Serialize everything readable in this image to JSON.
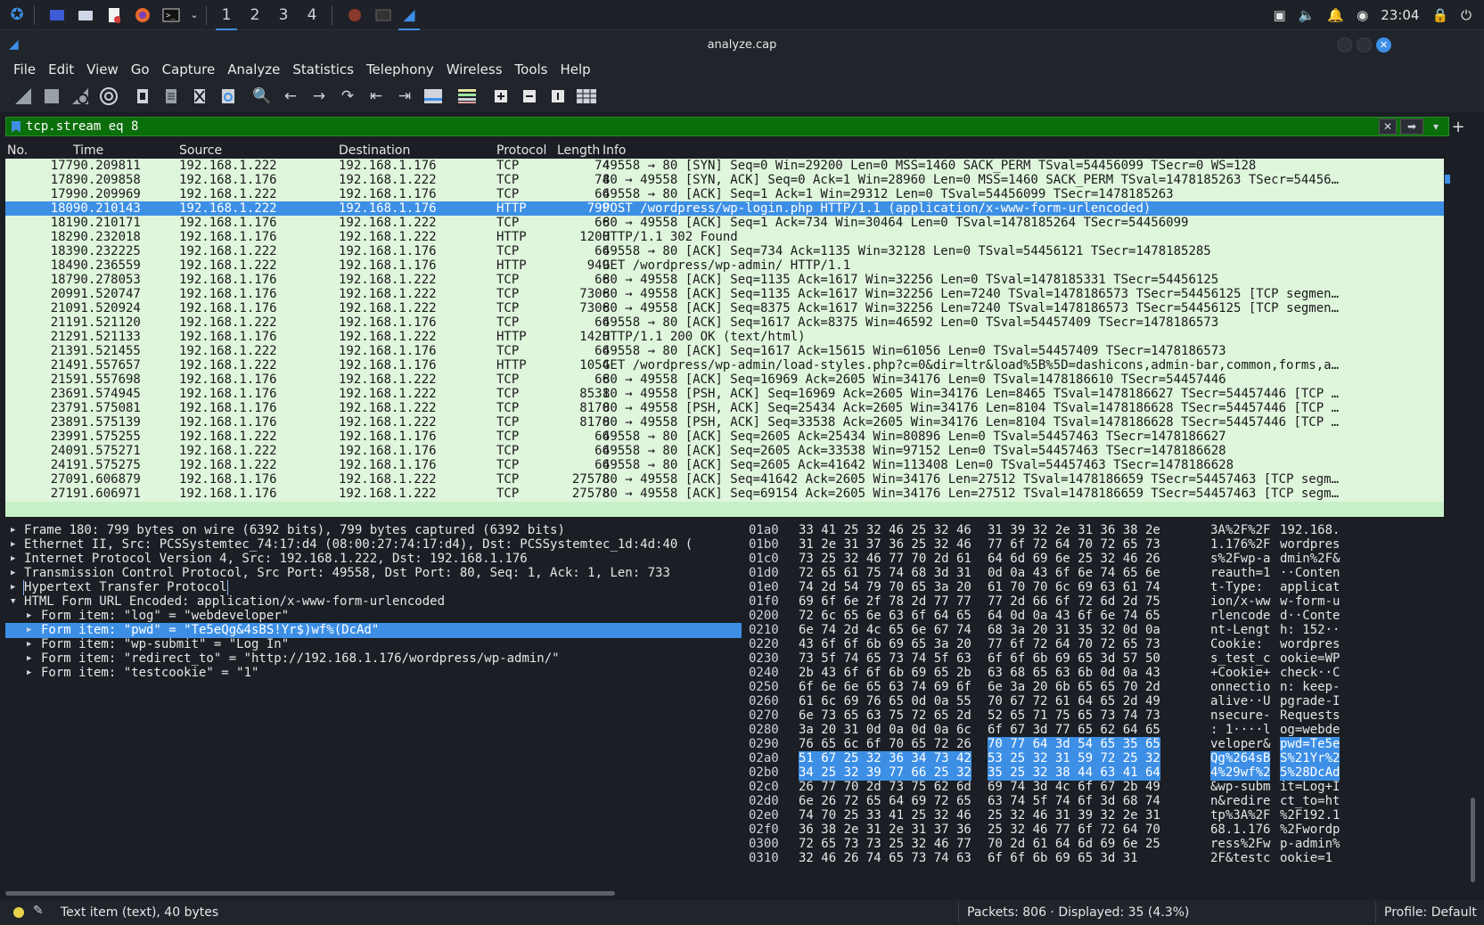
{
  "taskbar": {
    "workspaces": [
      "1",
      "2",
      "3",
      "4"
    ],
    "active_workspace": "1",
    "clock": "23:04"
  },
  "window": {
    "title": "analyze.cap"
  },
  "menu": [
    "File",
    "Edit",
    "View",
    "Go",
    "Capture",
    "Analyze",
    "Statistics",
    "Telephony",
    "Wireless",
    "Tools",
    "Help"
  ],
  "toolbar_icons": [
    "shark-fin-start-icon",
    "stop-capture-icon",
    "restart-capture-icon",
    "capture-options-icon",
    "open-file-icon",
    "save-file-icon",
    "close-file-icon",
    "reload-file-icon",
    "find-packet-icon",
    "go-back-icon",
    "go-forward-icon",
    "go-to-packet-icon",
    "first-packet-icon",
    "last-packet-icon",
    "autoscroll-icon",
    "colorize-icon",
    "zoom-in-icon",
    "zoom-out-icon",
    "normal-size-icon",
    "resize-columns-icon"
  ],
  "filter": {
    "value": "tcp.stream eq 8",
    "accent": "#0a6e0a"
  },
  "packet_list": {
    "columns": [
      "No.",
      "Time",
      "Source",
      "Destination",
      "Protocol",
      "Length",
      "Info"
    ],
    "rows": [
      {
        "no": "177",
        "time": "90.209811",
        "src": "192.168.1.222",
        "dst": "192.168.1.176",
        "proto": "TCP",
        "len": "74",
        "info": "49558 → 80 [SYN] Seq=0 Win=29200 Len=0 MSS=1460 SACK_PERM TSval=54456099 TSecr=0 WS=128"
      },
      {
        "no": "178",
        "time": "90.209858",
        "src": "192.168.1.176",
        "dst": "192.168.1.222",
        "proto": "TCP",
        "len": "74",
        "info": "80 → 49558 [SYN, ACK] Seq=0 Ack=1 Win=28960 Len=0 MSS=1460 SACK_PERM TSval=1478185263 TSecr=54456…"
      },
      {
        "no": "179",
        "time": "90.209969",
        "src": "192.168.1.222",
        "dst": "192.168.1.176",
        "proto": "TCP",
        "len": "66",
        "info": "49558 → 80 [ACK] Seq=1 Ack=1 Win=29312 Len=0 TSval=54456099 TSecr=1478185263"
      },
      {
        "no": "180",
        "time": "90.210143",
        "src": "192.168.1.222",
        "dst": "192.168.1.176",
        "proto": "HTTP",
        "len": "799",
        "info": "POST /wordpress/wp-login.php HTTP/1.1  (application/x-www-form-urlencoded)"
      },
      {
        "no": "181",
        "time": "90.210171",
        "src": "192.168.1.176",
        "dst": "192.168.1.222",
        "proto": "TCP",
        "len": "66",
        "info": "80 → 49558 [ACK] Seq=1 Ack=734 Win=30464 Len=0 TSval=1478185264 TSecr=54456099"
      },
      {
        "no": "182",
        "time": "90.232018",
        "src": "192.168.1.176",
        "dst": "192.168.1.222",
        "proto": "HTTP",
        "len": "1200",
        "info": "HTTP/1.1 302 Found"
      },
      {
        "no": "183",
        "time": "90.232225",
        "src": "192.168.1.222",
        "dst": "192.168.1.176",
        "proto": "TCP",
        "len": "66",
        "info": "49558 → 80 [ACK] Seq=734 Ack=1135 Win=32128 Len=0 TSval=54456121 TSecr=1478185285"
      },
      {
        "no": "184",
        "time": "90.236559",
        "src": "192.168.1.222",
        "dst": "192.168.1.176",
        "proto": "HTTP",
        "len": "949",
        "info": "GET /wordpress/wp-admin/ HTTP/1.1"
      },
      {
        "no": "187",
        "time": "90.278053",
        "src": "192.168.1.176",
        "dst": "192.168.1.222",
        "proto": "TCP",
        "len": "66",
        "info": "80 → 49558 [ACK] Seq=1135 Ack=1617 Win=32256 Len=0 TSval=1478185331 TSecr=54456125"
      },
      {
        "no": "209",
        "time": "91.520747",
        "src": "192.168.1.176",
        "dst": "192.168.1.222",
        "proto": "TCP",
        "len": "7306",
        "info": "80 → 49558 [ACK] Seq=1135 Ack=1617 Win=32256 Len=7240 TSval=1478186573 TSecr=54456125 [TCP segmen…"
      },
      {
        "no": "210",
        "time": "91.520924",
        "src": "192.168.1.176",
        "dst": "192.168.1.222",
        "proto": "TCP",
        "len": "7306",
        "info": "80 → 49558 [ACK] Seq=8375 Ack=1617 Win=32256 Len=7240 TSval=1478186573 TSecr=54456125 [TCP segmen…"
      },
      {
        "no": "211",
        "time": "91.521120",
        "src": "192.168.1.222",
        "dst": "192.168.1.176",
        "proto": "TCP",
        "len": "66",
        "info": "49558 → 80 [ACK] Seq=1617 Ack=8375 Win=46592 Len=0 TSval=54457409 TSecr=1478186573"
      },
      {
        "no": "212",
        "time": "91.521133",
        "src": "192.168.1.176",
        "dst": "192.168.1.222",
        "proto": "HTTP",
        "len": "1420",
        "info": "HTTP/1.1 200 OK  (text/html)"
      },
      {
        "no": "213",
        "time": "91.521455",
        "src": "192.168.1.222",
        "dst": "192.168.1.176",
        "proto": "TCP",
        "len": "66",
        "info": "49558 → 80 [ACK] Seq=1617 Ack=15615 Win=61056 Len=0 TSval=54457409 TSecr=1478186573"
      },
      {
        "no": "214",
        "time": "91.557657",
        "src": "192.168.1.222",
        "dst": "192.168.1.176",
        "proto": "HTTP",
        "len": "1054",
        "info": "GET /wordpress/wp-admin/load-styles.php?c=0&dir=ltr&load%5B%5D=dashicons,admin-bar,common,forms,a…"
      },
      {
        "no": "215",
        "time": "91.557698",
        "src": "192.168.1.176",
        "dst": "192.168.1.222",
        "proto": "TCP",
        "len": "66",
        "info": "80 → 49558 [ACK] Seq=16969 Ack=2605 Win=34176 Len=0 TSval=1478186610 TSecr=54457446"
      },
      {
        "no": "236",
        "time": "91.574945",
        "src": "192.168.1.176",
        "dst": "192.168.1.222",
        "proto": "TCP",
        "len": "8531",
        "info": "80 → 49558 [PSH, ACK] Seq=16969 Ack=2605 Win=34176 Len=8465 TSval=1478186627 TSecr=54457446 [TCP …"
      },
      {
        "no": "237",
        "time": "91.575081",
        "src": "192.168.1.176",
        "dst": "192.168.1.222",
        "proto": "TCP",
        "len": "8170",
        "info": "80 → 49558 [PSH, ACK] Seq=25434 Ack=2605 Win=34176 Len=8104 TSval=1478186628 TSecr=54457446 [TCP …"
      },
      {
        "no": "238",
        "time": "91.575139",
        "src": "192.168.1.176",
        "dst": "192.168.1.222",
        "proto": "TCP",
        "len": "8170",
        "info": "80 → 49558 [PSH, ACK] Seq=33538 Ack=2605 Win=34176 Len=8104 TSval=1478186628 TSecr=54457446 [TCP …"
      },
      {
        "no": "239",
        "time": "91.575255",
        "src": "192.168.1.222",
        "dst": "192.168.1.176",
        "proto": "TCP",
        "len": "66",
        "info": "49558 → 80 [ACK] Seq=2605 Ack=25434 Win=80896 Len=0 TSval=54457463 TSecr=1478186627"
      },
      {
        "no": "240",
        "time": "91.575271",
        "src": "192.168.1.222",
        "dst": "192.168.1.176",
        "proto": "TCP",
        "len": "66",
        "info": "49558 → 80 [ACK] Seq=2605 Ack=33538 Win=97152 Len=0 TSval=54457463 TSecr=1478186628"
      },
      {
        "no": "241",
        "time": "91.575275",
        "src": "192.168.1.222",
        "dst": "192.168.1.176",
        "proto": "TCP",
        "len": "66",
        "info": "49558 → 80 [ACK] Seq=2605 Ack=41642 Win=113408 Len=0 TSval=54457463 TSecr=1478186628"
      },
      {
        "no": "270",
        "time": "91.606879",
        "src": "192.168.1.176",
        "dst": "192.168.1.222",
        "proto": "TCP",
        "len": "27578",
        "info": "80 → 49558 [ACK] Seq=41642 Ack=2605 Win=34176 Len=27512 TSval=1478186659 TSecr=54457463 [TCP segm…"
      },
      {
        "no": "271",
        "time": "91.606971",
        "src": "192.168.1.176",
        "dst": "192.168.1.222",
        "proto": "TCP",
        "len": "27578",
        "info": "80 → 49558 [ACK] Seq=69154 Ack=2605 Win=34176 Len=27512 TSval=1478186659 TSecr=54457463 [TCP segm…"
      }
    ],
    "selected_no": "180"
  },
  "details": [
    {
      "text": "Frame 180: 799 bytes on wire (6392 bits), 799 bytes captured (6392 bits)",
      "indent": 0,
      "expanded": false
    },
    {
      "text": "Ethernet II, Src: PCSSystemtec_74:17:d4 (08:00:27:74:17:d4), Dst: PCSSystemtec_1d:4d:40 (",
      "indent": 0,
      "expanded": false
    },
    {
      "text": "Internet Protocol Version 4, Src: 192.168.1.222, Dst: 192.168.1.176",
      "indent": 0,
      "expanded": false
    },
    {
      "text": "Transmission Control Protocol, Src Port: 49558, Dst Port: 80, Seq: 1, Ack: 1, Len: 733",
      "indent": 0,
      "expanded": false
    },
    {
      "text": "Hypertext Transfer Protocol",
      "indent": 0,
      "expanded": false,
      "outlined": true
    },
    {
      "text": "HTML Form URL Encoded: application/x-www-form-urlencoded",
      "indent": 0,
      "expanded": true
    },
    {
      "text": "Form item: \"log\" = \"webdeveloper\"",
      "indent": 1,
      "expanded": false
    },
    {
      "text": "Form item: \"pwd\" = \"Te5eQg&4sBS!Yr$)wf%(DcAd\"",
      "indent": 1,
      "expanded": false,
      "selected": true
    },
    {
      "text": "Form item: \"wp-submit\" = \"Log In\"",
      "indent": 1,
      "expanded": false
    },
    {
      "text": "Form item: \"redirect_to\" = \"http://192.168.1.176/wordpress/wp-admin/\"",
      "indent": 1,
      "expanded": false
    },
    {
      "text": "Form item: \"testcookie\" = \"1\"",
      "indent": 1,
      "expanded": false
    }
  ],
  "bytes": [
    {
      "off": "01a0",
      "h1": "33 41 25 32 46 25 32 46",
      "h2": "31 39 32 2e 31 36 38 2e",
      "a1": "3A%2F%2F",
      "a2": "192.168."
    },
    {
      "off": "01b0",
      "h1": "31 2e 31 37 36 25 32 46",
      "h2": "77 6f 72 64 70 72 65 73",
      "a1": "1.176%2F",
      "a2": "wordpres"
    },
    {
      "off": "01c0",
      "h1": "73 25 32 46 77 70 2d 61",
      "h2": "64 6d 69 6e 25 32 46 26",
      "a1": "s%2Fwp-a",
      "a2": "dmin%2F&"
    },
    {
      "off": "01d0",
      "h1": "72 65 61 75 74 68 3d 31",
      "h2": "0d 0a 43 6f 6e 74 65 6e",
      "a1": "reauth=1",
      "a2": "··Conten"
    },
    {
      "off": "01e0",
      "h1": "74 2d 54 79 70 65 3a 20",
      "h2": "61 70 70 6c 69 63 61 74",
      "a1": "t-Type: ",
      "a2": "applicat"
    },
    {
      "off": "01f0",
      "h1": "69 6f 6e 2f 78 2d 77 77",
      "h2": "77 2d 66 6f 72 6d 2d 75",
      "a1": "ion/x-ww",
      "a2": "w-form-u"
    },
    {
      "off": "0200",
      "h1": "72 6c 65 6e 63 6f 64 65",
      "h2": "64 0d 0a 43 6f 6e 74 65",
      "a1": "rlencode",
      "a2": "d··Conte"
    },
    {
      "off": "0210",
      "h1": "6e 74 2d 4c 65 6e 67 74",
      "h2": "68 3a 20 31 35 32 0d 0a",
      "a1": "nt-Lengt",
      "a2": "h: 152··"
    },
    {
      "off": "0220",
      "h1": "43 6f 6f 6b 69 65 3a 20",
      "h2": "77 6f 72 64 70 72 65 73",
      "a1": "Cookie: ",
      "a2": "wordpres"
    },
    {
      "off": "0230",
      "h1": "73 5f 74 65 73 74 5f 63",
      "h2": "6f 6f 6b 69 65 3d 57 50",
      "a1": "s_test_c",
      "a2": "ookie=WP"
    },
    {
      "off": "0240",
      "h1": "2b 43 6f 6f 6b 69 65 2b",
      "h2": "63 68 65 63 6b 0d 0a 43",
      "a1": "+Cookie+",
      "a2": "check··C"
    },
    {
      "off": "0250",
      "h1": "6f 6e 6e 65 63 74 69 6f",
      "h2": "6e 3a 20 6b 65 65 70 2d",
      "a1": "onnectio",
      "a2": "n: keep-"
    },
    {
      "off": "0260",
      "h1": "61 6c 69 76 65 0d 0a 55",
      "h2": "70 67 72 61 64 65 2d 49",
      "a1": "alive··U",
      "a2": "pgrade-I"
    },
    {
      "off": "0270",
      "h1": "6e 73 65 63 75 72 65 2d",
      "h2": "52 65 71 75 65 73 74 73",
      "a1": "nsecure-",
      "a2": "Requests"
    },
    {
      "off": "0280",
      "h1": "3a 20 31 0d 0a 0d 0a 6c",
      "h2": "6f 67 3d 77 65 62 64 65",
      "a1": ": 1····l",
      "a2": "og=webde"
    },
    {
      "off": "0290",
      "h1": "76 65 6c 6f 70 65 72 26",
      "h2": "70 77 64 3d 54 65 35 65",
      "a1": "veloper&",
      "a2": "pwd=Te5e",
      "hl": "h2"
    },
    {
      "off": "02a0",
      "h1": "51 67 25 32 36 34 73 42",
      "h2": "53 25 32 31 59 72 25 32",
      "a1": "Qg%264sB",
      "a2": "S%21Yr%2",
      "hl": "all"
    },
    {
      "off": "02b0",
      "h1": "34 25 32 39 77 66 25 32",
      "h2": "35 25 32 38 44 63 41 64",
      "a1": "4%29wf%2",
      "a2": "5%28DcAd",
      "hl": "all"
    },
    {
      "off": "02c0",
      "h1": "26 77 70 2d 73 75 62 6d",
      "h2": "69 74 3d 4c 6f 67 2b 49",
      "a1": "&wp-subm",
      "a2": "it=Log+I"
    },
    {
      "off": "02d0",
      "h1": "6e 26 72 65 64 69 72 65",
      "h2": "63 74 5f 74 6f 3d 68 74",
      "a1": "n&redire",
      "a2": "ct_to=ht"
    },
    {
      "off": "02e0",
      "h1": "74 70 25 33 41 25 32 46",
      "h2": "25 32 46 31 39 32 2e 31",
      "a1": "tp%3A%2F",
      "a2": "%2F192.1"
    },
    {
      "off": "02f0",
      "h1": "36 38 2e 31 2e 31 37 36",
      "h2": "25 32 46 77 6f 72 64 70",
      "a1": "68.1.176",
      "a2": "%2Fwordp"
    },
    {
      "off": "0300",
      "h1": "72 65 73 73 25 32 46 77",
      "h2": "70 2d 61 64 6d 69 6e 25",
      "a1": "ress%2Fw",
      "a2": "p-admin%"
    },
    {
      "off": "0310",
      "h1": "32 46 26 74 65 73 74 63",
      "h2": "6f 6f 6b 69 65 3d 31",
      "a1": "2F&testc",
      "a2": "ookie=1"
    }
  ],
  "status": {
    "left": "Text item (text), 40 bytes",
    "middle": "Packets: 806 · Displayed: 35 (4.3%)",
    "right": "Profile: Default"
  },
  "colors": {
    "selection": "#3d8fe6",
    "tcp_row": "#dff5dc",
    "filter_ok": "#0a6e0a"
  }
}
